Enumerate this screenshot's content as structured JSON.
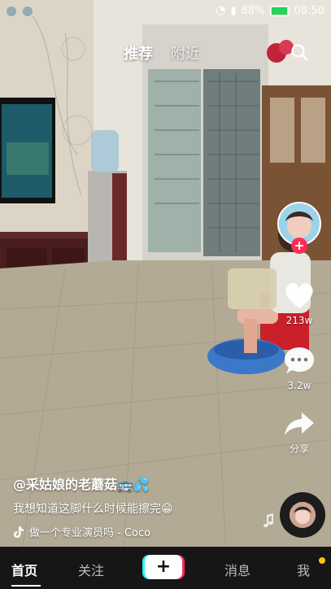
{
  "status_bar": {
    "battery_percent": "88%",
    "time": "08:50",
    "battery_color": "#27d35b"
  },
  "top_tabs": {
    "recommend": "推荐",
    "nearby": "附近"
  },
  "rail": {
    "likes": "213w",
    "comments": "3.2w",
    "share": "分享"
  },
  "caption": {
    "author": "@采姑娘的老蘑菇🚌💦",
    "description": "我想知道这脚什么时候能擦完😁",
    "music": "做一个专业演员吗 - Coco"
  },
  "bottom_nav": {
    "home": "首页",
    "following": "关注",
    "add": "+",
    "messages": "消息",
    "me": "我"
  },
  "colors": {
    "accent_red": "#fe2c55",
    "accent_cyan": "#25f4ee",
    "notify_dot": "#f7c21a"
  },
  "icons": [
    "search-icon",
    "heart-icon",
    "comment-icon",
    "share-icon",
    "music-note-icon",
    "tiktok-logo-icon"
  ]
}
